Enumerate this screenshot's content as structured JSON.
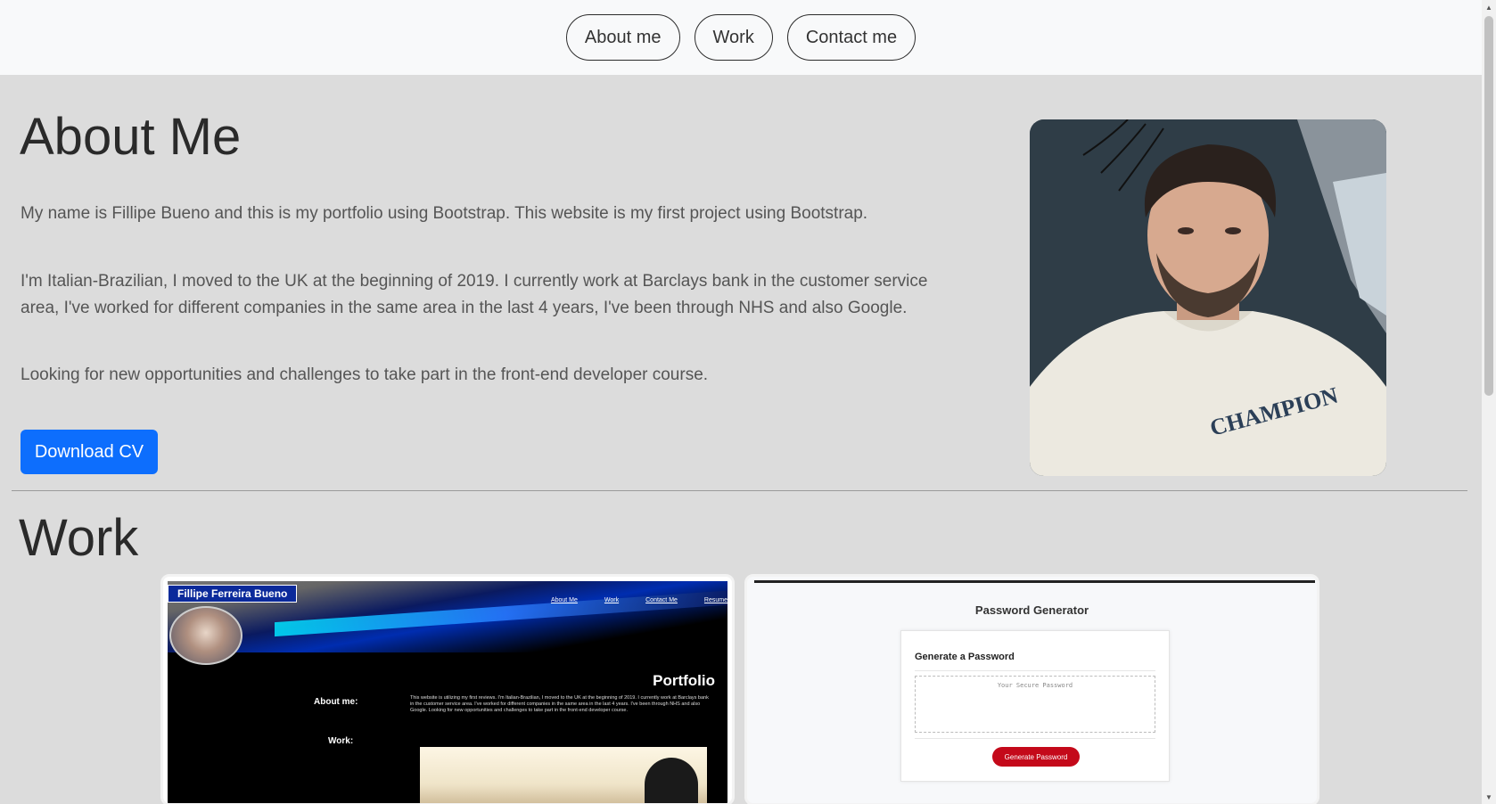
{
  "nav": {
    "items": [
      {
        "label": "About me"
      },
      {
        "label": "Work"
      },
      {
        "label": "Contact me"
      }
    ]
  },
  "about": {
    "title": "About Me",
    "paragraphs": [
      "My name is Fillipe Bueno and this is my portfolio using Bootstrap. This website is my first project using Bootstrap.",
      "I'm Italian-Brazilian, I moved to the UK at the beginning of 2019. I currently work at Barclays bank in the customer service area, I've worked for different companies in the same area in the last 4 years, I've been through NHS and also Google.",
      "Looking for new opportunities and challenges to take part in the front-end developer course."
    ],
    "cv_button": "Download CV",
    "photo_shirt_text": "CHAMPION"
  },
  "work": {
    "title": "Work",
    "card1": {
      "name_badge": "Fillipe Ferreira Bueno",
      "links": [
        "About Me",
        "Work",
        "Contact Me",
        "Resume"
      ],
      "heading": "Portfolio",
      "about_label": "About me:",
      "about_text": "This website is utilizing my first reviews. I'm Italian-Brazilian, I moved to the UK at the beginning of 2019. I currently work at Barclays bank in the customer service area. I've worked for different companies in the same area in the last 4 years. I've been through NHS and also Google. Looking for new opportunities and challenges to take part in the front-end developer course.",
      "work_label": "Work:"
    },
    "card2": {
      "title": "Password Generator",
      "subtitle": "Generate a Password",
      "placeholder": "Your Secure Password",
      "button": "Generate Password"
    }
  },
  "colors": {
    "accent": "#0d6efd",
    "page_bg": "#dcdcdc",
    "nav_bg": "#f8f9fa",
    "generate_btn": "#c4091a"
  }
}
